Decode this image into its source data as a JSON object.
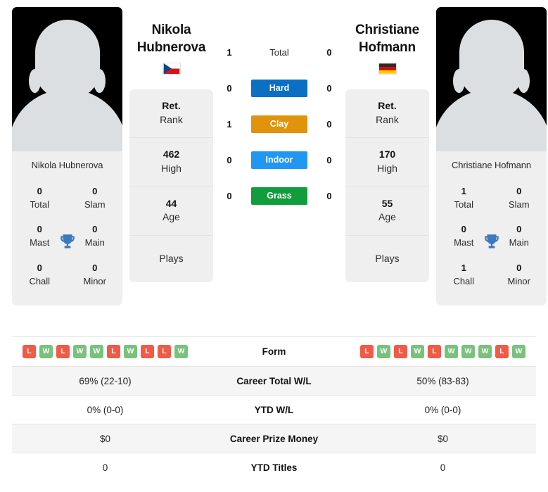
{
  "players": {
    "left": {
      "name_first": "Nikola",
      "name_last": "Hubnerova",
      "full_name": "Nikola Hubnerova",
      "country": "Czech Republic",
      "flag_icon": "flag-czech-republic",
      "avatar_icon": "player-photo-placeholder",
      "stats": [
        {
          "value": "Ret.",
          "label": "Rank"
        },
        {
          "value": "462",
          "label": "High"
        },
        {
          "value": "44",
          "label": "Age"
        },
        {
          "value": "",
          "label": "Plays"
        }
      ],
      "titles": [
        {
          "value": "0",
          "label": "Total"
        },
        {
          "value": "0",
          "label": "Slam"
        },
        {
          "value": "0",
          "label": "Mast"
        },
        {
          "value": "0",
          "label": "Main"
        },
        {
          "value": "0",
          "label": "Chall"
        },
        {
          "value": "0",
          "label": "Minor"
        }
      ],
      "form": [
        "L",
        "W",
        "L",
        "W",
        "W",
        "L",
        "W",
        "L",
        "L",
        "W"
      ],
      "career_total_wl": "69% (22-10)",
      "ytd_wl": "0% (0-0)",
      "career_prize_money": "$0",
      "ytd_titles": "0"
    },
    "right": {
      "name_first": "Christiane",
      "name_last": "Hofmann",
      "full_name": "Christiane Hofmann",
      "country": "Germany",
      "flag_icon": "flag-germany",
      "avatar_icon": "player-photo-placeholder",
      "stats": [
        {
          "value": "Ret.",
          "label": "Rank"
        },
        {
          "value": "170",
          "label": "High"
        },
        {
          "value": "55",
          "label": "Age"
        },
        {
          "value": "",
          "label": "Plays"
        }
      ],
      "titles": [
        {
          "value": "1",
          "label": "Total"
        },
        {
          "value": "0",
          "label": "Slam"
        },
        {
          "value": "0",
          "label": "Mast"
        },
        {
          "value": "0",
          "label": "Main"
        },
        {
          "value": "1",
          "label": "Chall"
        },
        {
          "value": "0",
          "label": "Minor"
        }
      ],
      "form": [
        "L",
        "W",
        "L",
        "W",
        "L",
        "W",
        "W",
        "W",
        "L",
        "W"
      ],
      "career_total_wl": "50% (83-83)",
      "ytd_wl": "0% (0-0)",
      "career_prize_money": "$0",
      "ytd_titles": "0"
    }
  },
  "head_to_head": [
    {
      "label": "Total",
      "left": "1",
      "right": "0",
      "color": "",
      "style": "plain"
    },
    {
      "label": "Hard",
      "left": "0",
      "right": "0",
      "color": "#0b6fc4",
      "style": "chip"
    },
    {
      "label": "Clay",
      "left": "1",
      "right": "0",
      "color": "#e0930b",
      "style": "chip"
    },
    {
      "label": "Indoor",
      "left": "0",
      "right": "0",
      "color": "#2196f3",
      "style": "chip"
    },
    {
      "label": "Grass",
      "left": "0",
      "right": "0",
      "color": "#119d3c",
      "style": "chip"
    }
  ],
  "comparison_rows": [
    {
      "label": "Form",
      "left": "",
      "right": "",
      "type": "form"
    },
    {
      "label": "Career Total W/L",
      "left": "69% (22-10)",
      "right": "50% (83-83)",
      "type": "text"
    },
    {
      "label": "YTD W/L",
      "left": "0% (0-0)",
      "right": "0% (0-0)",
      "type": "text"
    },
    {
      "label": "Career Prize Money",
      "left": "$0",
      "right": "$0",
      "type": "text"
    },
    {
      "label": "YTD Titles",
      "left": "0",
      "right": "0",
      "type": "text"
    }
  ],
  "colors": {
    "hard": "#0b6fc4",
    "clay": "#e0930b",
    "indoor": "#2196f3",
    "grass": "#119d3c",
    "win_badge": "#79c17d",
    "loss_badge": "#ef5b46",
    "card_bg": "#efefef",
    "trophy": "#3d79bf"
  }
}
